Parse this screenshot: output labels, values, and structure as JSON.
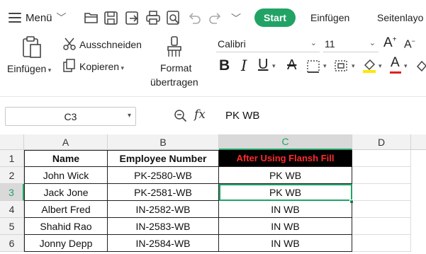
{
  "topbar": {
    "menu_label": "Menü",
    "start_label": "Start",
    "tabs": [
      "Einfügen",
      "Seitenlayo"
    ]
  },
  "ribbon": {
    "paste_label": "Einfügen",
    "cut_label": "Ausschneiden",
    "copy_label": "Kopieren",
    "format_label_1": "Format",
    "format_label_2": "übertragen",
    "font_name": "Calibri",
    "font_size": "11"
  },
  "formula_bar": {
    "cell_ref": "C3",
    "fx_label": "fx",
    "value": "PK WB"
  },
  "sheet": {
    "columns": [
      "A",
      "B",
      "C",
      "D"
    ],
    "rows": [
      "1",
      "2",
      "3",
      "4",
      "5",
      "6"
    ],
    "active_cell": "C3",
    "header_row": [
      "Name",
      "Employee Number",
      "After Using Flansh Fill"
    ],
    "data": [
      [
        "John Wick",
        "PK-2580-WB",
        "PK WB"
      ],
      [
        "Jack Jone",
        "PK-2581-WB",
        "PK WB"
      ],
      [
        "Albert Fred",
        "IN-2582-WB",
        "IN WB"
      ],
      [
        "Shahid Rao",
        "IN-2583-WB",
        "IN WB"
      ],
      [
        "Jonny Depp",
        "IN-2584-WB",
        "IN WB"
      ]
    ]
  },
  "colors": {
    "accent": "#21a366",
    "header_cell_bg": "#000000",
    "header_cell_text": "#ff2a2a",
    "selection": "#21a366"
  }
}
